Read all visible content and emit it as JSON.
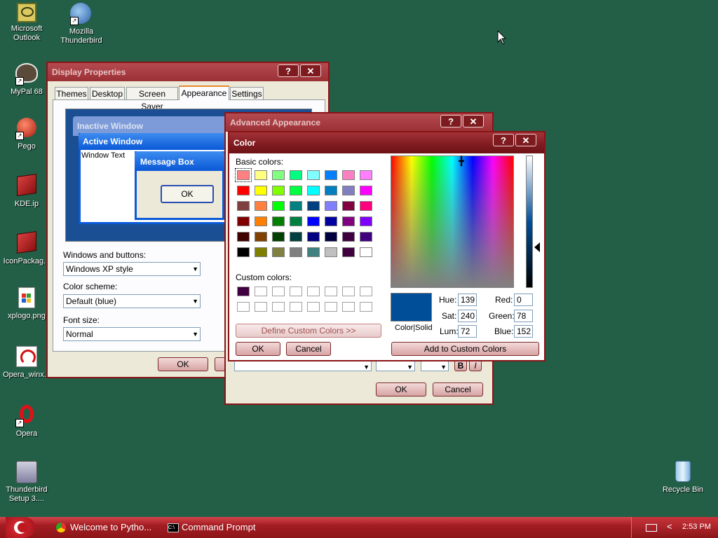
{
  "desktop": {
    "icons": [
      {
        "label": "Microsoft Outlook"
      },
      {
        "label": "Mozilla Thunderbird"
      },
      {
        "label": "MyPal 68"
      },
      {
        "label": "Pego"
      },
      {
        "label": "KDE.ip"
      },
      {
        "label": "IconPackag..."
      },
      {
        "label": "xplogo.png"
      },
      {
        "label": "Opera_winx..."
      },
      {
        "label": "Opera"
      },
      {
        "label": "Thunderbird Setup 3...."
      },
      {
        "label": "Recycle Bin"
      }
    ]
  },
  "display_properties": {
    "title": "Display Properties",
    "tabs": [
      "Themes",
      "Desktop",
      "Screen Saver",
      "Appearance",
      "Settings"
    ],
    "preview": {
      "inactive_title": "Inactive Window",
      "active_title": "Active Window",
      "window_text": "Window Text",
      "message_title": "Message Box",
      "ok": "OK"
    },
    "windows_buttons_label": "Windows and buttons:",
    "windows_buttons_value": "Windows XP style",
    "color_scheme_label": "Color scheme:",
    "color_scheme_value": "Default (blue)",
    "font_size_label": "Font size:",
    "font_size_value": "Normal",
    "ok": "OK"
  },
  "advanced_appearance": {
    "title": "Advanced Appearance",
    "ok": "OK",
    "cancel": "Cancel",
    "bold": "B",
    "italic": "I"
  },
  "color_dialog": {
    "title": "Color",
    "basic_label": "Basic colors:",
    "custom_label": "Custom colors:",
    "define_custom": "Define Custom Colors >>",
    "ok": "OK",
    "cancel": "Cancel",
    "add_custom": "Add to Custom Colors",
    "color_solid": "Color|Solid",
    "hue_label": "Hue:",
    "hue": "139",
    "sat_label": "Sat:",
    "sat": "240",
    "lum_label": "Lum:",
    "lum": "72",
    "red_label": "Red:",
    "red": "0",
    "green_label": "Green:",
    "green": "78",
    "blue_label": "Blue:",
    "blue": "152",
    "selected_color": "#004e98",
    "basic_colors": [
      "#ff8080",
      "#ffff80",
      "#80ff80",
      "#00ff80",
      "#80ffff",
      "#0080ff",
      "#ff80c0",
      "#ff80ff",
      "#ff0000",
      "#ffff00",
      "#80ff00",
      "#00ff40",
      "#00ffff",
      "#0080c0",
      "#8080c0",
      "#ff00ff",
      "#804040",
      "#ff8040",
      "#00ff00",
      "#008080",
      "#004080",
      "#8080ff",
      "#800040",
      "#ff0080",
      "#800000",
      "#ff8000",
      "#008000",
      "#008040",
      "#0000ff",
      "#0000a0",
      "#800080",
      "#8000ff",
      "#400000",
      "#804000",
      "#004000",
      "#004040",
      "#000080",
      "#000040",
      "#400040",
      "#400080",
      "#000000",
      "#808000",
      "#808040",
      "#808080",
      "#408080",
      "#c0c0c0",
      "#400040",
      "#ffffff"
    ],
    "custom_colors": [
      "#400040"
    ]
  },
  "taskbar": {
    "tasks": [
      "Welcome to Pytho...",
      "Command Prompt"
    ],
    "clock": "2:53 PM"
  }
}
